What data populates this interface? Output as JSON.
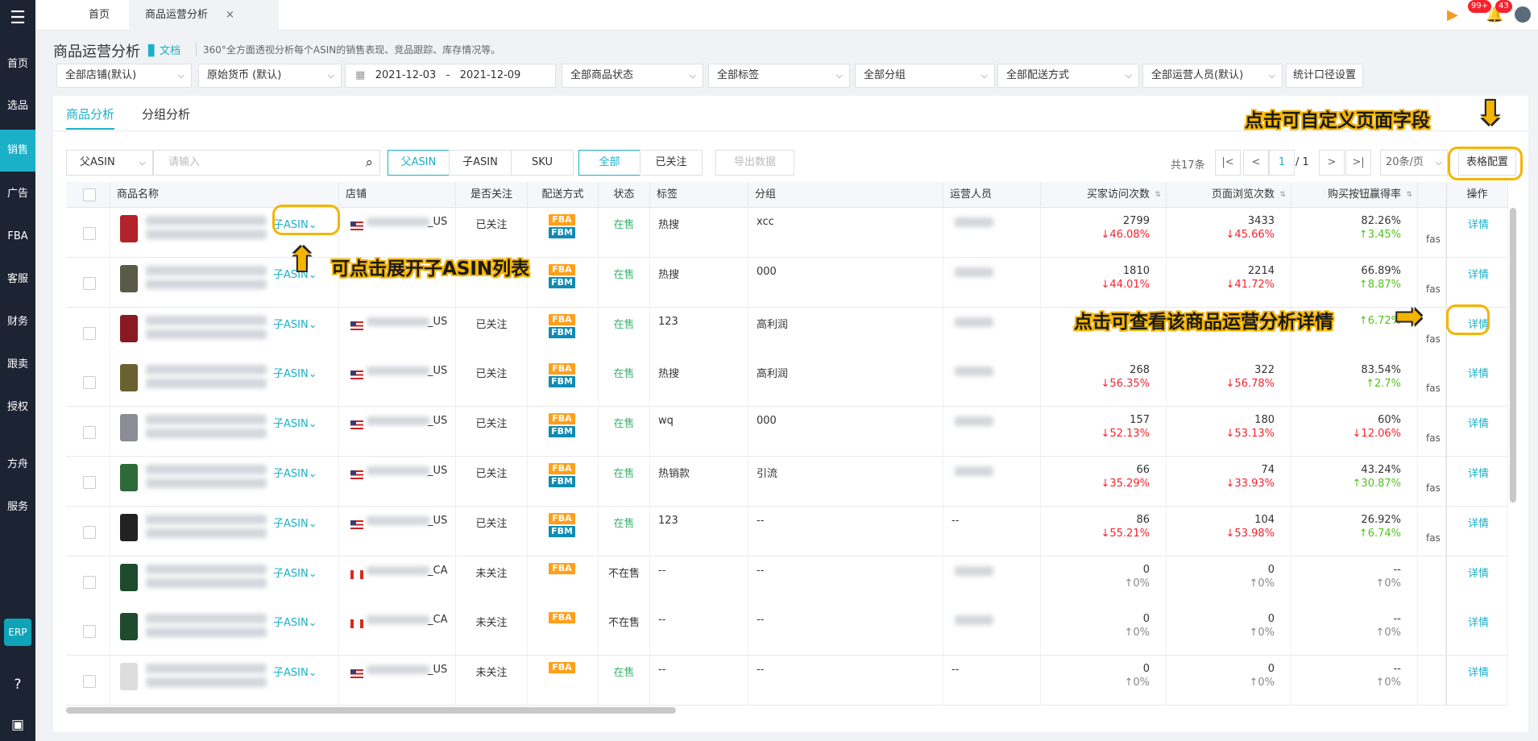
{
  "sidebar": {
    "logo_icon": "logo-icon",
    "items": [
      "首页",
      "选品",
      "销售",
      "广告",
      "FBA",
      "客服",
      "财务",
      "跟卖",
      "授权",
      "方舟",
      "服务"
    ],
    "erp": "ERP"
  },
  "topbar": {
    "tab_home": "首页",
    "tab_current": "商品运营分析",
    "close": "×",
    "badge1": "99+",
    "badge2": "43"
  },
  "page": {
    "title": "商品运营分析",
    "doc": "文档",
    "desc": "360°全方面透视分析每个ASIN的销售表现、竞品跟踪、库存情况等。"
  },
  "filters": {
    "store": "全部店铺(默认)",
    "currency": "原始货币 (默认)",
    "date_from": "2021-12-03",
    "date_sep": "-",
    "date_to": "2021-12-09",
    "status": "全部商品状态",
    "tag": "全部标签",
    "group": "全部分组",
    "shipping": "全部配送方式",
    "operator": "全部运营人员(默认)",
    "stat": "统计口径设置"
  },
  "tabs": [
    "商品分析",
    "分组分析"
  ],
  "toolbar": {
    "search_type": "父ASIN",
    "search_placeholder": "请输入",
    "btn_parent": "父ASIN",
    "btn_child": "子ASIN",
    "btn_sku": "SKU",
    "btn_all": "全部",
    "btn_followed": "已关注",
    "btn_export": "导出数据",
    "total": "共17条",
    "page": "1",
    "page_total": "/ 1",
    "page_size": "20条/页",
    "table_config": "表格配置"
  },
  "annotations": {
    "a1": "点击可自定义页面字段",
    "a2": "可点击展开子ASIN列表",
    "a3": "点击可查看该商品运营分析详情"
  },
  "table": {
    "headers": [
      "商品名称",
      "店铺",
      "是否关注",
      "配送方式",
      "状态",
      "标签",
      "分组",
      "运营人员",
      "买家访问次数",
      "页面浏览次数",
      "购买按钮赢得率",
      "操作"
    ],
    "sub_asin": "子ASIN",
    "detail": "详情",
    "rows": [
      {
        "store_sfx": "_US",
        "flag": "us",
        "follow": "已关注",
        "fba": "FBA",
        "fbm": "FBM",
        "status": "在售",
        "tag": "热搜",
        "group": "xcc",
        "op": "",
        "v1": "2799",
        "c1": "↓46.08%",
        "v2": "3433",
        "c2": "↓45.66%",
        "v3": "82.26%",
        "c3": "↑3.45%",
        "fas": "fas"
      },
      {
        "store_sfx": "",
        "flag": "",
        "follow": "",
        "fba": "FBA",
        "fbm": "FBM",
        "status": "在售",
        "tag": "热搜",
        "group": "000",
        "op": "",
        "v1": "1810",
        "c1": "↓44.01%",
        "v2": "2214",
        "c2": "↓41.72%",
        "v3": "66.89%",
        "c3": "↑8.87%",
        "fas": "fas"
      },
      {
        "store_sfx": "_US",
        "flag": "us",
        "follow": "已关注",
        "fba": "FBA",
        "fbm": "FBM",
        "status": "在售",
        "tag": "123",
        "group": "高利润",
        "op": "",
        "v1": "",
        "c1": "↓31.77%",
        "v2": "",
        "c2": "↓30.27%",
        "v3": "",
        "c3": "↑6.72%",
        "fas": "fas"
      },
      {
        "store_sfx": "_US",
        "flag": "us",
        "follow": "已关注",
        "fba": "FBA",
        "fbm": "FBM",
        "status": "在售",
        "tag": "热搜",
        "group": "高利润",
        "op": "",
        "v1": "268",
        "c1": "↓56.35%",
        "v2": "322",
        "c2": "↓56.78%",
        "v3": "83.54%",
        "c3": "↑2.7%",
        "fas": "fas"
      },
      {
        "store_sfx": "_US",
        "flag": "us",
        "follow": "已关注",
        "fba": "FBA",
        "fbm": "FBM",
        "status": "在售",
        "tag": "wq",
        "group": "000",
        "op": "",
        "v1": "157",
        "c1": "↓52.13%",
        "v2": "180",
        "c2": "↓53.13%",
        "v3": "60%",
        "c3": "↓12.06%",
        "fas": "fas"
      },
      {
        "store_sfx": "_US",
        "flag": "us",
        "follow": "已关注",
        "fba": "FBA",
        "fbm": "FBM",
        "status": "在售",
        "tag": "热销款",
        "group": "引流",
        "op": "",
        "v1": "66",
        "c1": "↓35.29%",
        "v2": "74",
        "c2": "↓33.93%",
        "v3": "43.24%",
        "c3": "↑30.87%",
        "fas": "fas"
      },
      {
        "store_sfx": "_US",
        "flag": "us",
        "follow": "已关注",
        "fba": "FBA",
        "fbm": "FBM",
        "status": "在售",
        "tag": "123",
        "group": "--",
        "op": "--",
        "v1": "86",
        "c1": "↓55.21%",
        "v2": "104",
        "c2": "↓53.98%",
        "v3": "26.92%",
        "c3": "↑6.74%",
        "fas": "fas"
      },
      {
        "store_sfx": "_CA",
        "flag": "ca",
        "follow": "未关注",
        "fba": "FBA",
        "fbm": "",
        "status": "不在售",
        "tag": "--",
        "group": "--",
        "op": "",
        "v1": "0",
        "c1": "↑0%",
        "v2": "0",
        "c2": "↑0%",
        "v3": "--",
        "c3": "↑0%",
        "fas": ""
      },
      {
        "store_sfx": "_CA",
        "flag": "ca",
        "follow": "未关注",
        "fba": "FBA",
        "fbm": "",
        "status": "不在售",
        "tag": "--",
        "group": "--",
        "op": "",
        "v1": "0",
        "c1": "↑0%",
        "v2": "0",
        "c2": "↑0%",
        "v3": "--",
        "c3": "↑0%",
        "fas": ""
      },
      {
        "store_sfx": "_US",
        "flag": "us",
        "follow": "未关注",
        "fba": "FBA",
        "fbm": "",
        "status": "在售",
        "tag": "--",
        "group": "--",
        "op": "--",
        "v1": "0",
        "c1": "↑0%",
        "v2": "0",
        "c2": "↑0%",
        "v3": "--",
        "c3": "↑0%",
        "fas": ""
      }
    ]
  }
}
